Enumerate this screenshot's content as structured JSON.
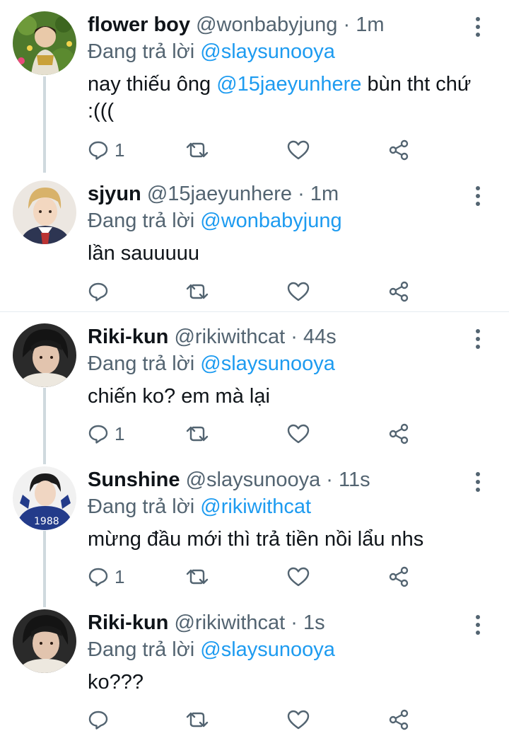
{
  "colors": {
    "accent": "#1d9bf0",
    "secondary_text": "#536471",
    "thread_line": "#cfd9de"
  },
  "reply_prefix": "Đang trả lời",
  "tweets": [
    {
      "name": "flower boy",
      "handle": "@wonbabyjung",
      "time": "1m",
      "reply_to": "@slaysunooya",
      "body_parts": [
        "nay thiếu ông ",
        "@15jaeyunhere",
        " bùn tht chứ :((("
      ],
      "reply_count": "1",
      "avatar_icon": "avatar-photo"
    },
    {
      "name": "sjyun",
      "handle": "@15jaeyunhere",
      "time": "1m",
      "reply_to": "@wonbabyjung",
      "body_parts": [
        "lần sauuuuu"
      ],
      "reply_count": "",
      "avatar_icon": "avatar-photo"
    },
    {
      "name": "Riki-kun",
      "handle": "@rikiwithcat",
      "time": "44s",
      "reply_to": "@slaysunooya",
      "body_parts": [
        "chiến ko? em mà lại"
      ],
      "reply_count": "1",
      "avatar_icon": "avatar-photo"
    },
    {
      "name": "Sunshine",
      "handle": "@slaysunooya",
      "time": "11s",
      "reply_to": "@rikiwithcat",
      "body_parts": [
        "mừng đầu mới thì trả tiền nồi lẩu nhs"
      ],
      "reply_count": "1",
      "avatar_icon": "avatar-photo"
    },
    {
      "name": "Riki-kun",
      "handle": "@rikiwithcat",
      "time": "1s",
      "reply_to": "@slaysunooya",
      "body_parts": [
        "ko???"
      ],
      "reply_count": "",
      "avatar_icon": "avatar-photo"
    }
  ],
  "action_icons": [
    "reply-icon",
    "retweet-icon",
    "like-icon",
    "share-icon"
  ]
}
